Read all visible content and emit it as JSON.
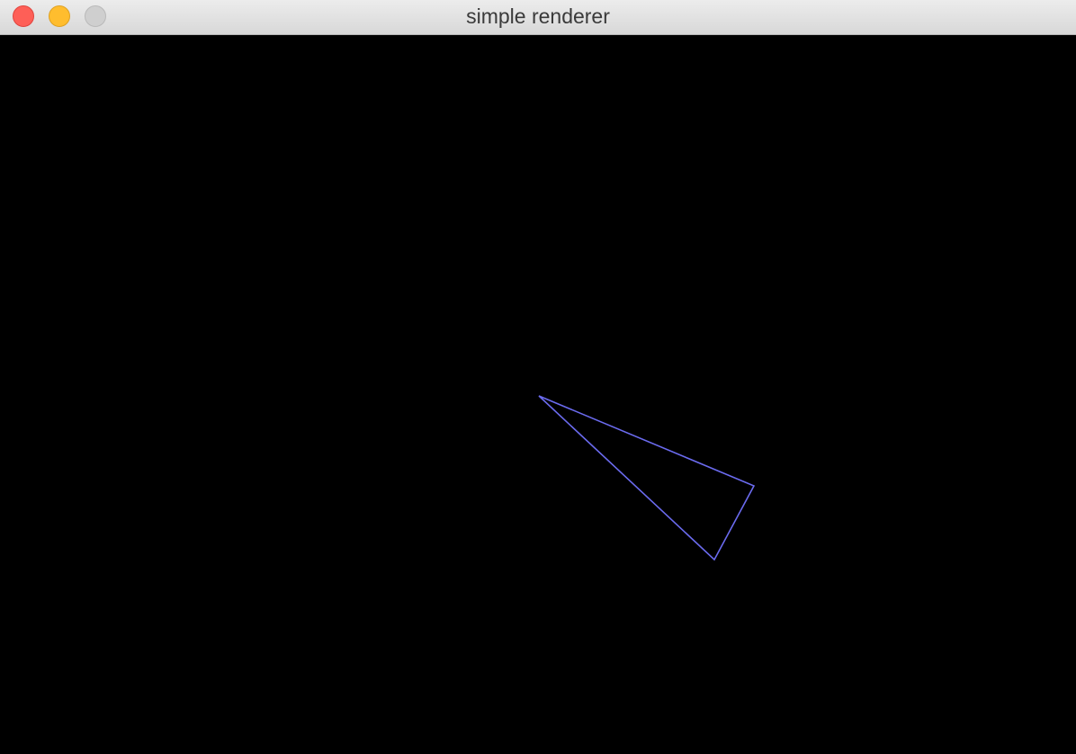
{
  "window": {
    "title": "simple renderer",
    "buttons": [
      {
        "name": "close",
        "color": "#fe5f57",
        "border": "#e0443e"
      },
      {
        "name": "minimize",
        "color": "#ffbd2e",
        "border": "#dea123"
      },
      {
        "name": "zoom",
        "color": "#cfcfcf",
        "border": "#b9b9b9"
      }
    ]
  },
  "scene": {
    "background": "#000000",
    "stroke_color": "#6b6bef",
    "shape": "triangle-wireframe"
  }
}
